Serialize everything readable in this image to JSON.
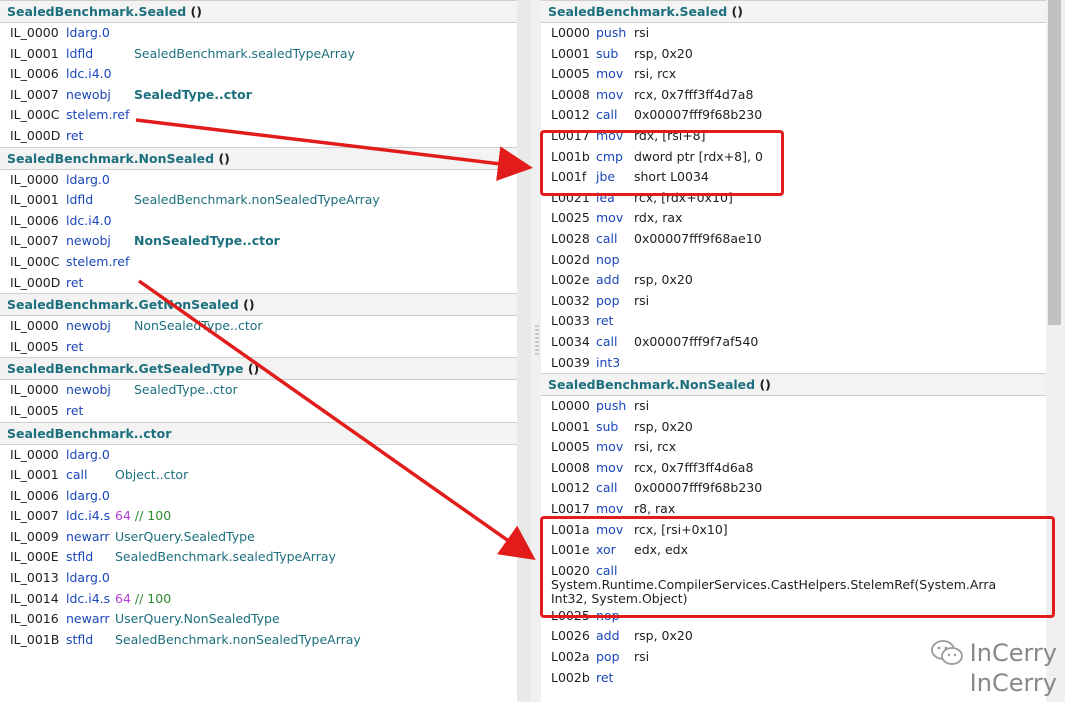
{
  "left_pane": {
    "sections": [
      {
        "title": "SealedBenchmark.Sealed",
        "paren": "()",
        "rows": [
          {
            "addr": "IL_0000",
            "op": "ldarg.0",
            "arg": ""
          },
          {
            "addr": "IL_0001",
            "op": "ldfld",
            "arg": "SealedBenchmark.sealedTypeArray"
          },
          {
            "addr": "IL_0006",
            "op": "ldc.i4.0",
            "arg": ""
          },
          {
            "addr": "IL_0007",
            "op": "newobj",
            "arg": "SealedType..ctor",
            "bold": true
          },
          {
            "addr": "IL_000C",
            "op": "stelem.ref",
            "arg": ""
          },
          {
            "addr": "IL_000D",
            "op": "ret",
            "arg": ""
          }
        ]
      },
      {
        "title": "SealedBenchmark.NonSealed",
        "paren": "()",
        "rows": [
          {
            "addr": "IL_0000",
            "op": "ldarg.0",
            "arg": ""
          },
          {
            "addr": "IL_0001",
            "op": "ldfld",
            "arg": "SealedBenchmark.nonSealedTypeArray"
          },
          {
            "addr": "IL_0006",
            "op": "ldc.i4.0",
            "arg": ""
          },
          {
            "addr": "IL_0007",
            "op": "newobj",
            "arg": "NonSealedType..ctor",
            "bold": true
          },
          {
            "addr": "IL_000C",
            "op": "stelem.ref",
            "arg": ""
          },
          {
            "addr": "IL_000D",
            "op": "ret",
            "arg": ""
          }
        ]
      },
      {
        "title": "SealedBenchmark.GetNonSealed",
        "paren": "()",
        "rows": [
          {
            "addr": "IL_0000",
            "op": "newobj",
            "arg": "NonSealedType..ctor"
          },
          {
            "addr": "IL_0005",
            "op": "ret",
            "arg": ""
          }
        ]
      },
      {
        "title": "SealedBenchmark.GetSealedType",
        "paren": "()",
        "rows": [
          {
            "addr": "IL_0000",
            "op": "newobj",
            "arg": "SealedType..ctor"
          },
          {
            "addr": "IL_0005",
            "op": "ret",
            "arg": ""
          }
        ]
      },
      {
        "title": "SealedBenchmark..ctor",
        "paren": "",
        "rows": [
          {
            "addr": "IL_0000",
            "op": "ldarg.0",
            "arg": ""
          },
          {
            "addr": "IL_0001",
            "op": "call",
            "arg": "Object..ctor"
          },
          {
            "addr": "IL_0006",
            "op": "ldarg.0",
            "arg": ""
          },
          {
            "addr": "IL_0007",
            "op": "ldc.i4.s",
            "num": "64",
            "cmt": "// 100"
          },
          {
            "addr": "IL_0009",
            "op": "newarr",
            "arg": "UserQuery.SealedType"
          },
          {
            "addr": "IL_000E",
            "op": "stfld",
            "arg": "SealedBenchmark.sealedTypeArray"
          },
          {
            "addr": "IL_0013",
            "op": "ldarg.0",
            "arg": ""
          },
          {
            "addr": "IL_0014",
            "op": "ldc.i4.s",
            "num": "64",
            "cmt": "// 100"
          },
          {
            "addr": "IL_0016",
            "op": "newarr",
            "arg": "UserQuery.NonSealedType"
          },
          {
            "addr": "IL_001B",
            "op": "stfld",
            "arg": "SealedBenchmark.nonSealedTypeArray"
          }
        ]
      }
    ]
  },
  "right_pane": {
    "sections": [
      {
        "title": "SealedBenchmark.Sealed",
        "paren": "()",
        "rows": [
          {
            "addr": "L0000",
            "op": "push",
            "arg": "rsi"
          },
          {
            "addr": "L0001",
            "op": "sub",
            "arg": "rsp, 0x20"
          },
          {
            "addr": "L0005",
            "op": "mov",
            "arg": "rsi, rcx"
          },
          {
            "addr": "L0008",
            "op": "mov",
            "arg": "rcx, 0x7fff3ff4d7a8"
          },
          {
            "addr": "L0012",
            "op": "call",
            "arg": "0x00007fff9f68b230"
          },
          {
            "addr": "L0017",
            "op": "mov",
            "arg": "rdx, [rsi+8]"
          },
          {
            "addr": "L001b",
            "op": "cmp",
            "arg": "dword ptr [rdx+8], 0"
          },
          {
            "addr": "L001f",
            "op": "jbe",
            "arg": "short L0034"
          },
          {
            "addr": "L0021",
            "op": "lea",
            "arg": "rcx, [rdx+0x10]"
          },
          {
            "addr": "L0025",
            "op": "mov",
            "arg": "rdx, rax"
          },
          {
            "addr": "L0028",
            "op": "call",
            "arg": "0x00007fff9f68ae10"
          },
          {
            "addr": "L002d",
            "op": "nop",
            "arg": ""
          },
          {
            "addr": "L002e",
            "op": "add",
            "arg": "rsp, 0x20"
          },
          {
            "addr": "L0032",
            "op": "pop",
            "arg": "rsi"
          },
          {
            "addr": "L0033",
            "op": "ret",
            "arg": ""
          },
          {
            "addr": "L0034",
            "op": "call",
            "arg": "0x00007fff9f7af540"
          },
          {
            "addr": "L0039",
            "op": "int3",
            "arg": ""
          }
        ]
      },
      {
        "title": "SealedBenchmark.NonSealed",
        "paren": "()",
        "rows": [
          {
            "addr": "L0000",
            "op": "push",
            "arg": "rsi"
          },
          {
            "addr": "L0001",
            "op": "sub",
            "arg": "rsp, 0x20"
          },
          {
            "addr": "L0005",
            "op": "mov",
            "arg": "rsi, rcx"
          },
          {
            "addr": "L0008",
            "op": "mov",
            "arg": "rcx, 0x7fff3ff4d6a8"
          },
          {
            "addr": "L0012",
            "op": "call",
            "arg": "0x00007fff9f68b230"
          },
          {
            "addr": "L0017",
            "op": "mov",
            "arg": "r8, rax"
          },
          {
            "addr": "L001a",
            "op": "mov",
            "arg": "rcx, [rsi+0x10]"
          },
          {
            "addr": "L001e",
            "op": "xor",
            "arg": "edx, edx"
          },
          {
            "addr": "L0020",
            "op": "call",
            "arg": "System.Runtime.CompilerServices.CastHelpers.StelemRef(System.Arra Int32, System.Object)",
            "wrap": true
          },
          {
            "addr": "L0025",
            "op": "nop",
            "arg": ""
          },
          {
            "addr": "L0026",
            "op": "add",
            "arg": "rsp, 0x20"
          },
          {
            "addr": "L002a",
            "op": "pop",
            "arg": "rsi"
          },
          {
            "addr": "L002b",
            "op": "ret",
            "arg": ""
          }
        ]
      }
    ]
  },
  "watermark": {
    "line1": "InCerry",
    "line2": "InCerry"
  },
  "colors": {
    "type_ref": "#1c6f7d",
    "opcode": "#1a47b8",
    "number": "#b43fd6",
    "comment": "#2f8a2f",
    "highlight": "#e21b1b"
  }
}
